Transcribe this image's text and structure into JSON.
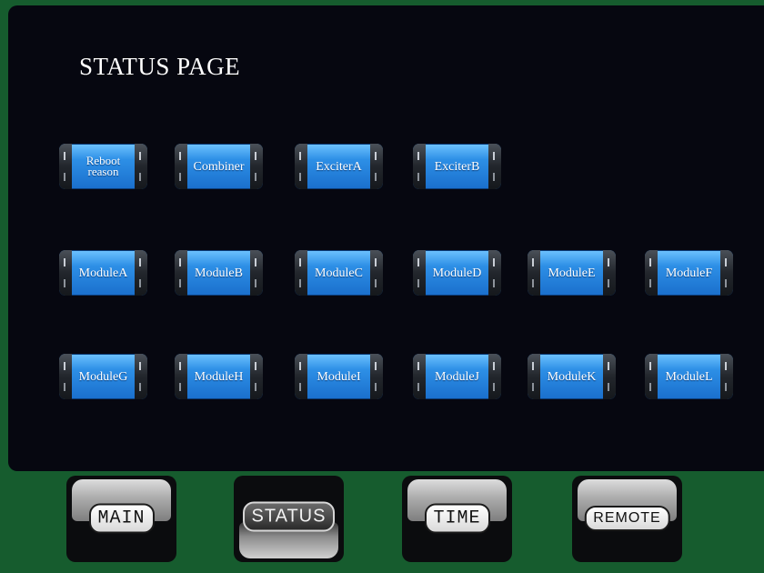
{
  "page_title": "STATUS PAGE",
  "rows": [
    [
      "Reboot\nreason",
      "Combiner",
      "ExciterA",
      "ExciterB"
    ],
    [
      "ModuleA",
      "ModuleB",
      "ModuleC",
      "ModuleD",
      "ModuleE",
      "ModuleF"
    ],
    [
      "ModuleG",
      "ModuleH",
      "ModuleI",
      "ModuleJ",
      "ModuleK",
      "ModuleL"
    ]
  ],
  "nav": [
    {
      "label": "MAIN",
      "active": false
    },
    {
      "label": "STATUS",
      "active": true
    },
    {
      "label": "TIME",
      "active": false
    },
    {
      "label": "REMOTE",
      "active": false
    }
  ],
  "colors": {
    "background_green": "#165c2e",
    "panel": "#060710",
    "button_blue": "#2d8fe6"
  }
}
